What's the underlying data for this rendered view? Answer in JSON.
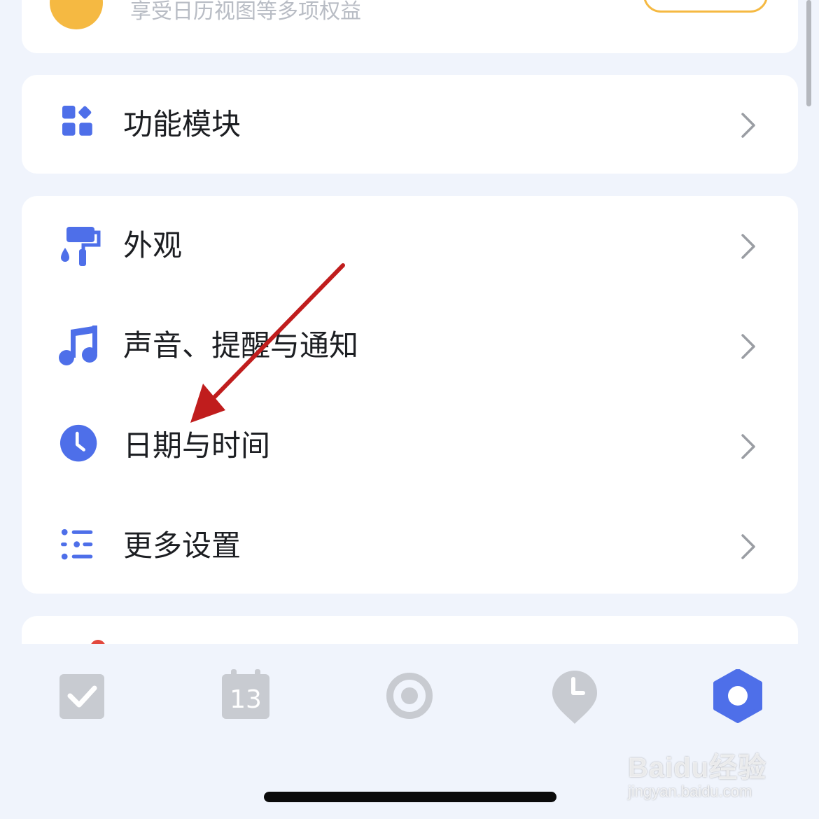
{
  "premium_card": {
    "subtitle": "享受日历视图等多项权益"
  },
  "features_card": {
    "label": "功能模块",
    "icon": "grid-blocks-icon"
  },
  "settings": [
    {
      "label": "外观",
      "icon": "paint-roller-icon"
    },
    {
      "label": "声音、提醒与通知",
      "icon": "music-note-icon"
    },
    {
      "label": "日期与时间",
      "icon": "clock-icon"
    },
    {
      "label": "更多设置",
      "icon": "list-settings-icon"
    }
  ],
  "tab_bar": {
    "tabs": [
      {
        "icon": "task-check-icon",
        "active": false
      },
      {
        "icon": "calendar-icon",
        "day": "13",
        "active": false
      },
      {
        "icon": "focus-ring-icon",
        "active": false
      },
      {
        "icon": "location-clock-icon",
        "active": false
      },
      {
        "icon": "settings-hexagon-icon",
        "active": true
      }
    ]
  },
  "colors": {
    "accent": "#4e6fe9",
    "background": "#f0f4fc",
    "premium": "#f5b942",
    "inactive_icon": "#c8cbd1",
    "annotation_arrow": "#c01d1d"
  },
  "watermark": {
    "brand": "Baidu经验",
    "url": "jingyan.baidu.com"
  }
}
